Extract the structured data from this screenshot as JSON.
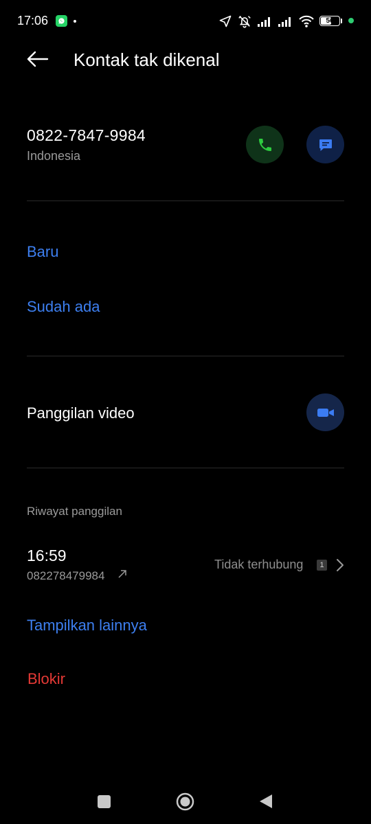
{
  "status_bar": {
    "time": "17:06",
    "battery_level": "56",
    "icons": [
      "whatsapp-icon",
      "location-arrow-icon",
      "alarm-off-icon",
      "signal-icon",
      "signal-icon",
      "wifi-icon",
      "battery-icon"
    ]
  },
  "header": {
    "title": "Kontak tak dikenal",
    "back_icon": "back-arrow-icon"
  },
  "contact": {
    "number": "0822-7847-9984",
    "country": "Indonesia",
    "actions": [
      "phone-icon",
      "message-icon"
    ]
  },
  "add_contact": {
    "new_label": "Baru",
    "existing_label": "Sudah ada"
  },
  "video_call": {
    "label": "Panggilan video",
    "icon": "video-camera-icon"
  },
  "history": {
    "section_label": "Riwayat panggilan",
    "entries": [
      {
        "time": "16:59",
        "number": "082278479984",
        "direction_icon": "outgoing-arrow-icon",
        "status": "Tidak terhubung",
        "sim": "1"
      }
    ],
    "show_more_label": "Tampilkan lainnya"
  },
  "block_label": "Blokir",
  "colors": {
    "background": "#000000",
    "link_blue": "#3d7ff0",
    "block_red": "#e53935",
    "call_green": "#2ecc40",
    "message_blue": "#3b7cf2"
  }
}
